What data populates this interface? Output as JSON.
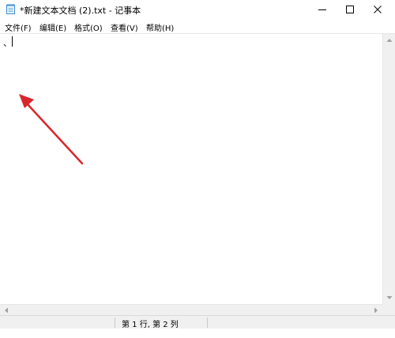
{
  "window": {
    "title": "*新建文本文档 (2).txt - 记事本"
  },
  "menu": {
    "file": "文件(F)",
    "edit": "编辑(E)",
    "format": "格式(O)",
    "view": "查看(V)",
    "help": "帮助(H)"
  },
  "editor": {
    "content": "、"
  },
  "status": {
    "position": "第 1 行, 第 2 列"
  },
  "colors": {
    "annotation_arrow": "#d9262c"
  }
}
